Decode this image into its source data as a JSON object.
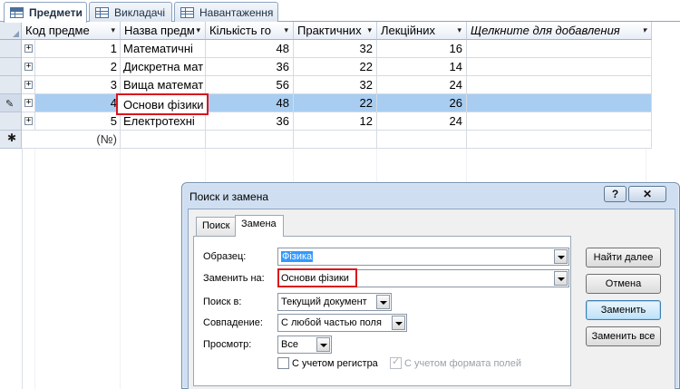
{
  "tabs": [
    {
      "label": "Предмети",
      "active": true
    },
    {
      "label": "Викладачі",
      "active": false
    },
    {
      "label": "Навантаження",
      "active": false
    }
  ],
  "table": {
    "columns": [
      "Код предме",
      "Назва предм",
      "Кількість го",
      "Практичних",
      "Лекційних",
      "Щелкните для добавления"
    ],
    "rows": [
      {
        "code": "1",
        "name": "Математичні",
        "hours": "48",
        "practical": "32",
        "lectures": "16"
      },
      {
        "code": "2",
        "name": "Дискретна мат",
        "hours": "36",
        "practical": "22",
        "lectures": "14"
      },
      {
        "code": "3",
        "name": "Вища математ",
        "hours": "56",
        "practical": "32",
        "lectures": "24"
      },
      {
        "code": "4",
        "name": "Основи фізики",
        "hours": "48",
        "practical": "22",
        "lectures": "26"
      },
      {
        "code": "5",
        "name": "Електротехні",
        "hours": "36",
        "practical": "12",
        "lectures": "24"
      }
    ],
    "new_row_code": "(№)",
    "highlight_color": "#a8cdf1"
  },
  "dialog": {
    "title": "Поиск и замена",
    "help": "?",
    "close": "✕",
    "tabs": [
      "Поиск",
      "Замена"
    ],
    "active_tab": "Замена",
    "find_label": "Образец:",
    "find_value": "Фізика",
    "replace_label": "Заменить на:",
    "replace_value": "Основи фізики",
    "lookin_label": "Поиск в:",
    "lookin_value": "Текущий документ",
    "match_label": "Совпадение:",
    "match_value": "С любой частью поля",
    "search_label": "Просмотр:",
    "search_value": "Все",
    "match_case": "С учетом регистра",
    "search_formatted": "С учетом формата полей",
    "buttons": {
      "find_next": "Найти далее",
      "cancel": "Отмена",
      "replace": "Заменить",
      "replace_all": "Заменить все"
    }
  },
  "colors": {
    "annotation_red": "#d9161c",
    "selection_blue": "#3399ff"
  }
}
